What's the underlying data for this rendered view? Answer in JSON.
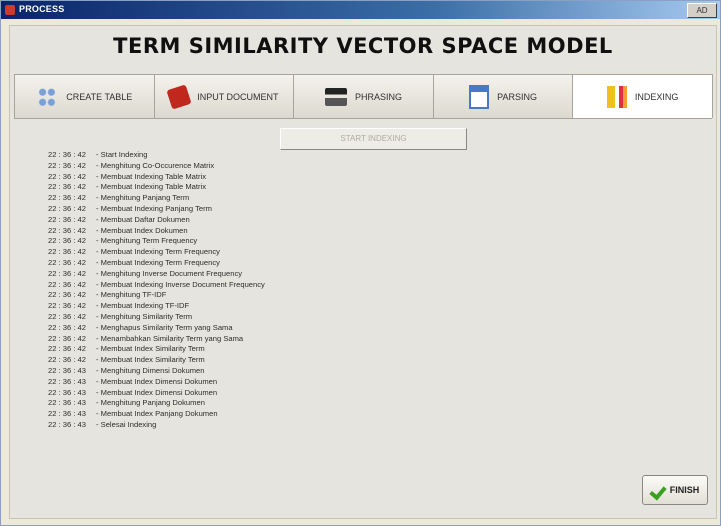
{
  "window": {
    "title": "PROCESS",
    "controls_label": "AD"
  },
  "heading": "TERM SIMILARITY VECTOR SPACE MODEL",
  "tabs": [
    {
      "label": "CREATE TABLE",
      "icon": "table-icon"
    },
    {
      "label": "INPUT DOCUMENT",
      "icon": "input-document-icon"
    },
    {
      "label": "PHRASING",
      "icon": "phrasing-icon"
    },
    {
      "label": "PARSING",
      "icon": "parsing-icon"
    },
    {
      "label": "INDEXING",
      "icon": "indexing-icon",
      "active": true
    }
  ],
  "start_button": {
    "label": "START INDEXING",
    "enabled": false
  },
  "log": [
    {
      "time": "22 : 36 : 42",
      "msg": "- Start Indexing"
    },
    {
      "time": "22 : 36 : 42",
      "msg": "- Menghitung Co-Occurence Matrix"
    },
    {
      "time": "22 : 36 : 42",
      "msg": "- Membuat Indexing Table Matrix"
    },
    {
      "time": "22 : 36 : 42",
      "msg": "- Membuat Indexing Table Matrix"
    },
    {
      "time": "22 : 36 : 42",
      "msg": "- Menghitung Panjang Term"
    },
    {
      "time": "22 : 36 : 42",
      "msg": "- Membuat Indexing Panjang Term"
    },
    {
      "time": "22 : 36 : 42",
      "msg": "- Membuat Daftar Dokumen"
    },
    {
      "time": "22 : 36 : 42",
      "msg": "- Membuat Index Dokumen"
    },
    {
      "time": "22 : 36 : 42",
      "msg": "- Menghitung Term Frequency"
    },
    {
      "time": "22 : 36 : 42",
      "msg": "- Membuat Indexing Term Frequency"
    },
    {
      "time": "22 : 36 : 42",
      "msg": "- Membuat Indexing Term Frequency"
    },
    {
      "time": "22 : 36 : 42",
      "msg": "- Menghitung Inverse Document Frequency"
    },
    {
      "time": "22 : 36 : 42",
      "msg": "- Membuat Indexing Inverse Document Frequency"
    },
    {
      "time": "22 : 36 : 42",
      "msg": "- Menghitung TF-IDF"
    },
    {
      "time": "22 : 36 : 42",
      "msg": "- Membuat Indexing TF-IDF"
    },
    {
      "time": "22 : 36 : 42",
      "msg": "- Menghitung Similarity Term"
    },
    {
      "time": "22 : 36 : 42",
      "msg": "- Menghapus Similarity Term yang Sama"
    },
    {
      "time": "22 : 36 : 42",
      "msg": "- Menambahkan Similarity Term yang Sama"
    },
    {
      "time": "22 : 36 : 42",
      "msg": "- Membuat Index Similarity Term"
    },
    {
      "time": "22 : 36 : 42",
      "msg": "- Membuat Index Similarity Term"
    },
    {
      "time": "22 : 36 : 43",
      "msg": "- Menghitung Dimensi Dokumen"
    },
    {
      "time": "22 : 36 : 43",
      "msg": "- Membuat Index Dimensi Dokumen"
    },
    {
      "time": "22 : 36 : 43",
      "msg": "- Membuat Index Dimensi Dokumen"
    },
    {
      "time": "22 : 36 : 43",
      "msg": "- Menghitung Panjang Dokumen"
    },
    {
      "time": "22 : 36 : 43",
      "msg": "- Membuat Index Panjang Dokumen"
    },
    {
      "time": "22 : 36 : 43",
      "msg": "- Selesai Indexing"
    }
  ],
  "finish_button": {
    "label": "FINISH",
    "icon": "check-icon"
  }
}
